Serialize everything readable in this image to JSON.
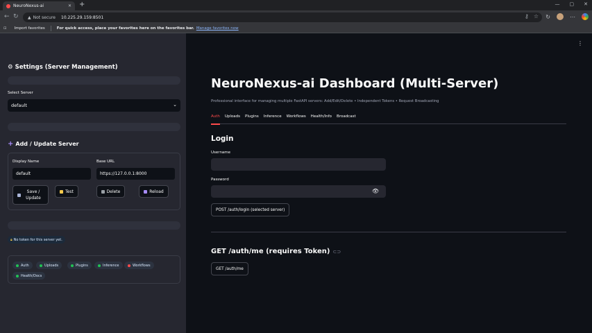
{
  "browser": {
    "tab_title": "NeuroNexus-ai",
    "tab_close": "✕",
    "new_tab": "+",
    "url_warning": "Not secure",
    "url": "10.225.29.159:8501",
    "bookmarks": {
      "import": "Import favorites",
      "hint": "For quick access, place your favorites here on the favorites bar.",
      "manage_link": "Manage favorites now"
    }
  },
  "sidebar": {
    "title": "Settings (Server Management)",
    "select_label": "Select Server",
    "select_value": "default",
    "add_title": "Add / Update Server",
    "display_name_label": "Display Name",
    "display_name_value": "default",
    "base_url_label": "Base URL",
    "base_url_value": "https://127.0.0.1:8000",
    "buttons": {
      "save": "Save / Update",
      "test": "Test",
      "delete": "Delete",
      "reload": "Reload"
    },
    "token_status": "No token for this server yet.",
    "chips": [
      {
        "label": "Auth",
        "color": "#21c354"
      },
      {
        "label": "Uploads",
        "color": "#21c354"
      },
      {
        "label": "Plugins",
        "color": "#21c354"
      },
      {
        "label": "Inference",
        "color": "#21c354"
      },
      {
        "label": "Workflows",
        "color": "#ff4b4b"
      },
      {
        "label": "Health/Docs",
        "color": "#21c354"
      }
    ]
  },
  "main": {
    "title": "NeuroNexus-ai Dashboard (Multi-Server)",
    "subtitle": "Professional interface for managing multiple FastAPI servers: Add/Edit/Delete • Independent Tokens • Request Broadcasting",
    "tabs": [
      "Auth",
      "Uploads",
      "Plugins",
      "Inference",
      "Workflows",
      "Health/Info",
      "Broadcast"
    ],
    "login_heading": "Login",
    "username_label": "Username",
    "password_label": "Password",
    "login_button": "POST /auth/login (selected server)",
    "getme_heading": "GET /auth/me (requires Token)",
    "getme_button": "GET /auth/me"
  },
  "colors": {
    "accent": "#ff4b4b",
    "sidebar_bg": "#262730",
    "main_bg": "#0e1117"
  }
}
